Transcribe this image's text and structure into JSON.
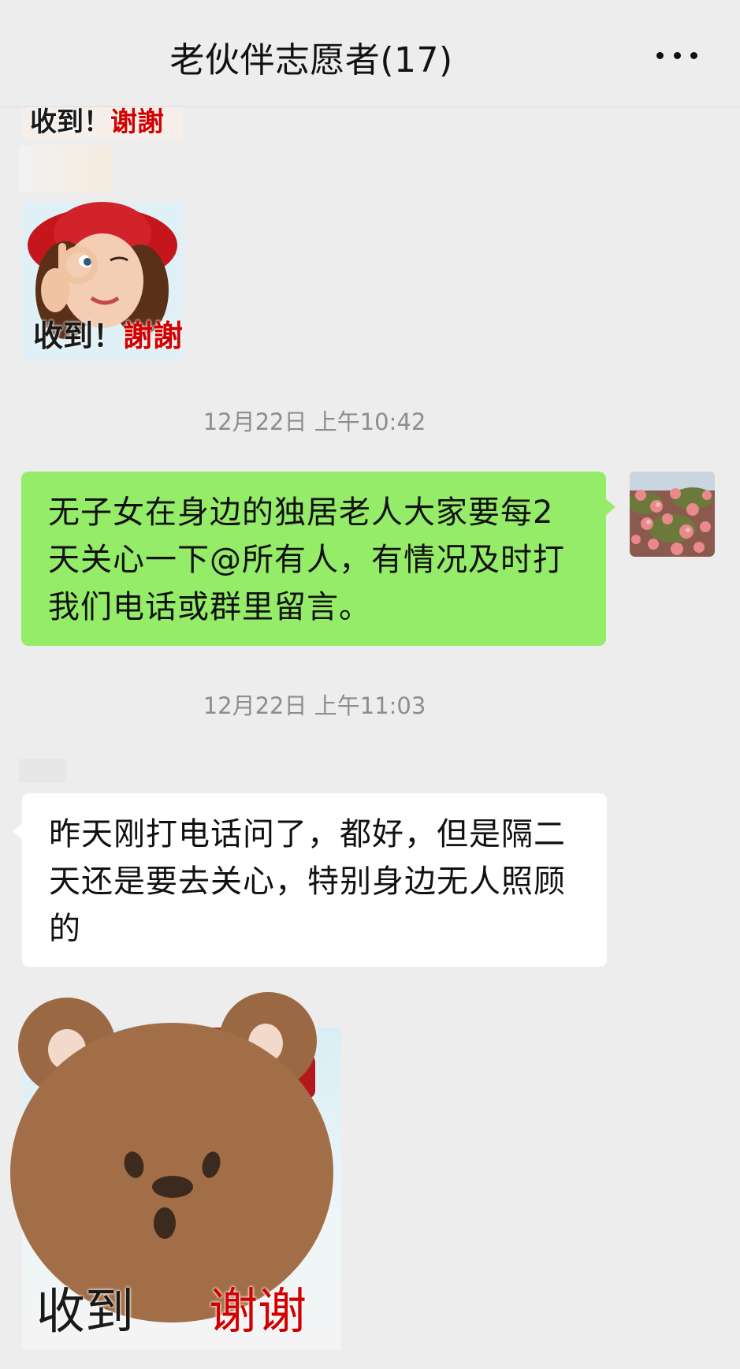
{
  "header": {
    "title": "老伙伴志愿者(17)"
  },
  "stickers": [
    {
      "caption_black": "收到！",
      "caption_red": "谢謝"
    },
    {
      "caption_black": "收到！",
      "caption_red": "謝謝"
    },
    {
      "caption_black": "收到",
      "caption_red": "谢谢"
    }
  ],
  "messages": [
    {
      "timestamp": "12月22日 上午10:42",
      "text": "无子女在身边的独居老人大家要每2天关心一下@所有人，有情况及时打我们电话或群里留言。"
    },
    {
      "timestamp": "12月22日 上午11:03",
      "text": "昨天刚打电话问了，都好，但是隔二天还是要去关心，特别身边无人照顾的"
    }
  ],
  "colors": {
    "background": "#ededed",
    "self_bubble": "#95ec69",
    "other_bubble": "#ffffff",
    "timestamp": "#8d8d8d"
  }
}
